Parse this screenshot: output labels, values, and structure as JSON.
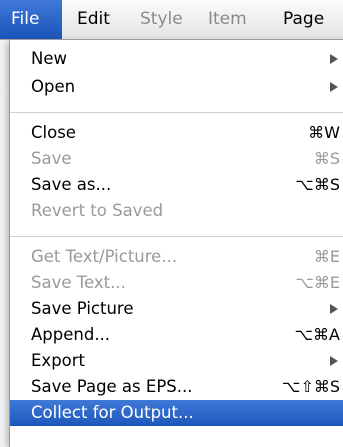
{
  "menubar": {
    "items": [
      {
        "label": "File",
        "state": "active"
      },
      {
        "label": "Edit",
        "state": "normal"
      },
      {
        "label": "Style",
        "state": "disabled"
      },
      {
        "label": "Item",
        "state": "disabled"
      },
      {
        "label": "Page",
        "state": "normal"
      }
    ]
  },
  "file_menu": {
    "new": {
      "label": "New",
      "has_submenu": true
    },
    "open": {
      "label": "Open",
      "has_submenu": true
    },
    "close": {
      "label": "Close",
      "shortcut": "⌘W"
    },
    "save": {
      "label": "Save",
      "shortcut": "⌘S",
      "disabled": true
    },
    "save_as": {
      "label": "Save as...",
      "shortcut": "⌥⌘S"
    },
    "revert": {
      "label": "Revert to Saved",
      "disabled": true
    },
    "get_text_picture": {
      "label": "Get Text/Picture...",
      "shortcut": "⌘E",
      "disabled": true
    },
    "save_text": {
      "label": "Save Text...",
      "shortcut": "⌥⌘E",
      "disabled": true
    },
    "save_picture": {
      "label": "Save Picture",
      "has_submenu": true
    },
    "append": {
      "label": "Append...",
      "shortcut": "⌥⌘A"
    },
    "export": {
      "label": "Export",
      "has_submenu": true
    },
    "save_page_eps": {
      "label": "Save Page as EPS...",
      "shortcut": "⌥⇧⌘S"
    },
    "collect_for_output": {
      "label": "Collect for Output...",
      "highlighted": true
    }
  },
  "colors": {
    "highlight": "#1d57bb",
    "disabled_text": "#9a9a9a"
  }
}
